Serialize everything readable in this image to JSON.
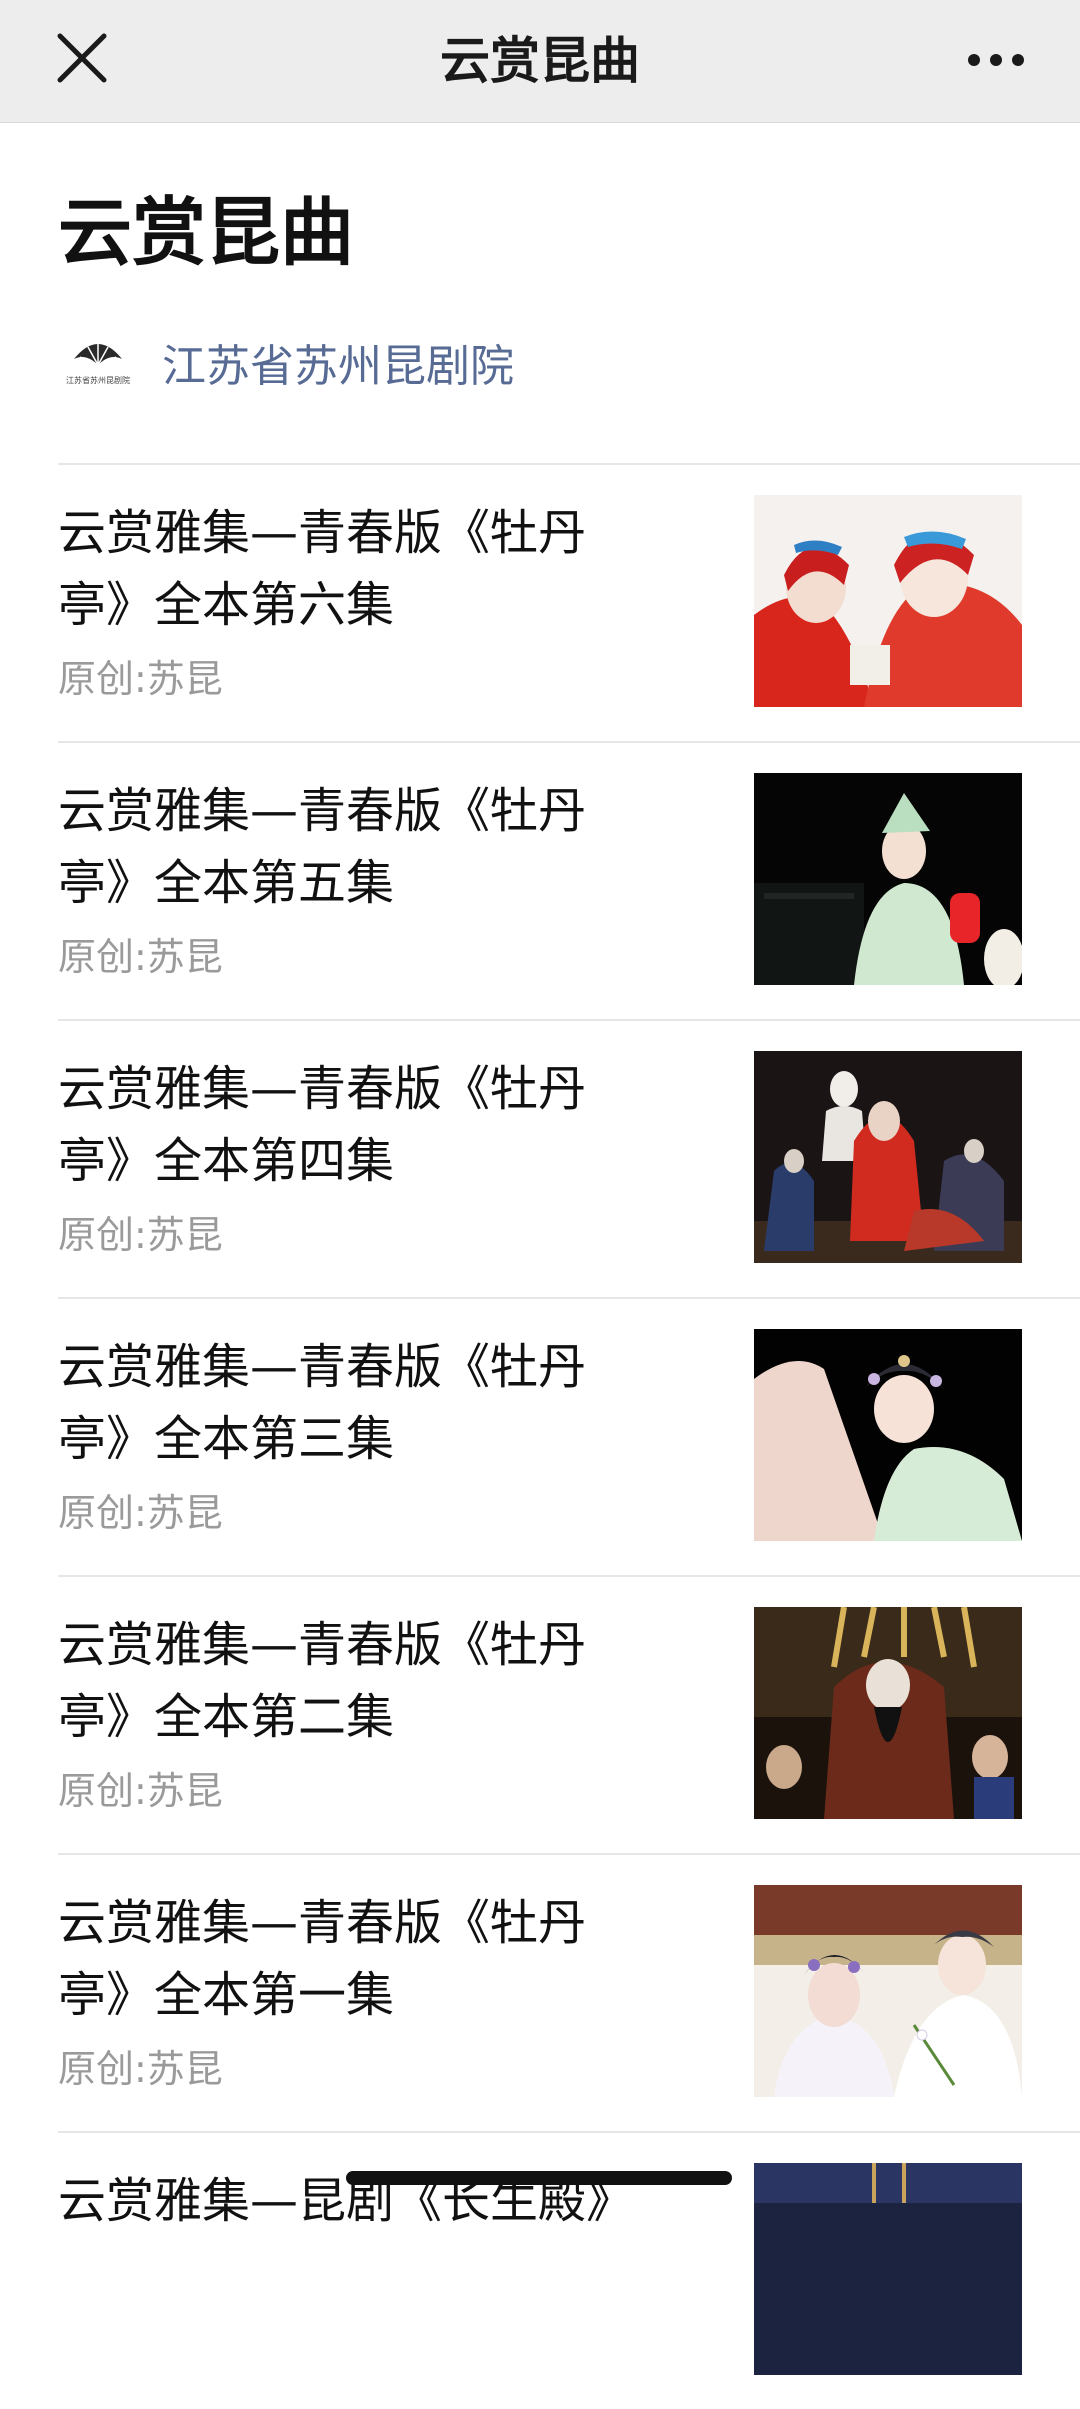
{
  "nav": {
    "title": "云赏昆曲",
    "close_icon": "close-icon",
    "more_icon": "more-dots-icon"
  },
  "album": {
    "title": "云赏昆曲",
    "account_name": "江苏省苏州昆剧院",
    "account_logo_icon": "fan-logo-icon",
    "account_logo_text": "江苏省苏州昆剧院",
    "account_name_color": "#576b95"
  },
  "items": [
    {
      "title": "云赏雅集—青春版《牡丹亭》全本第六集",
      "source": "原创:苏昆"
    },
    {
      "title": "云赏雅集—青春版《牡丹亭》全本第五集",
      "source": "原创:苏昆"
    },
    {
      "title": "云赏雅集—青春版《牡丹亭》全本第四集",
      "source": "原创:苏昆"
    },
    {
      "title": "云赏雅集—青春版《牡丹亭》全本第三集",
      "source": "原创:苏昆"
    },
    {
      "title": "云赏雅集—青春版《牡丹亭》全本第二集",
      "source": "原创:苏昆"
    },
    {
      "title": "云赏雅集—青春版《牡丹亭》全本第一集",
      "source": "原创:苏昆"
    },
    {
      "title": "云赏雅集—昆剧《长生殿》",
      "source": ""
    }
  ]
}
